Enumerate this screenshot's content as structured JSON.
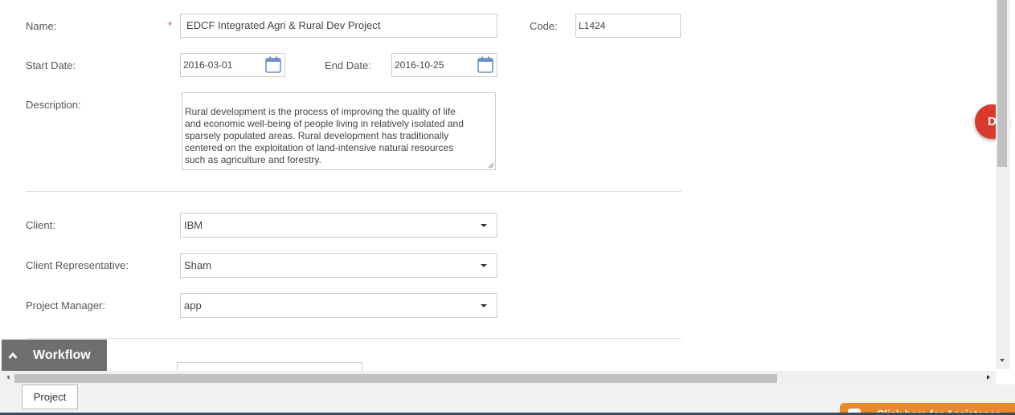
{
  "form": {
    "name_label": "Name:",
    "required_marker": "*",
    "name_value": "EDCF Integrated Agri & Rural Dev Project",
    "code_label": "Code:",
    "code_value": "L1424",
    "start_date_label": "Start Date:",
    "start_date_value": "2016-03-01",
    "end_date_label": "End Date:",
    "end_date_value": "2016-10-25",
    "description_label": "Description:",
    "description_value": "Rural development is the process of improving the quality of life\nand economic well-being of people living in relatively isolated and\nsparsely populated areas. Rural development has traditionally\ncentered on the exploitation of land-intensive natural resources\nsuch as agriculture and forestry.",
    "client_label": "Client:",
    "client_value": "IBM",
    "client_rep_label": "Client Representative:",
    "client_rep_value": "Sham",
    "project_manager_label": "Project Manager:",
    "project_manager_value": "app"
  },
  "avatar": {
    "initial": "D",
    "color": "#d93a2b"
  },
  "workflow": {
    "label": "Workflow",
    "icon": "chevron-up-icon"
  },
  "bottom": {
    "tab_label": "Project",
    "assist_label": "Click here for Assistance",
    "assist_color": "#e8892a"
  }
}
